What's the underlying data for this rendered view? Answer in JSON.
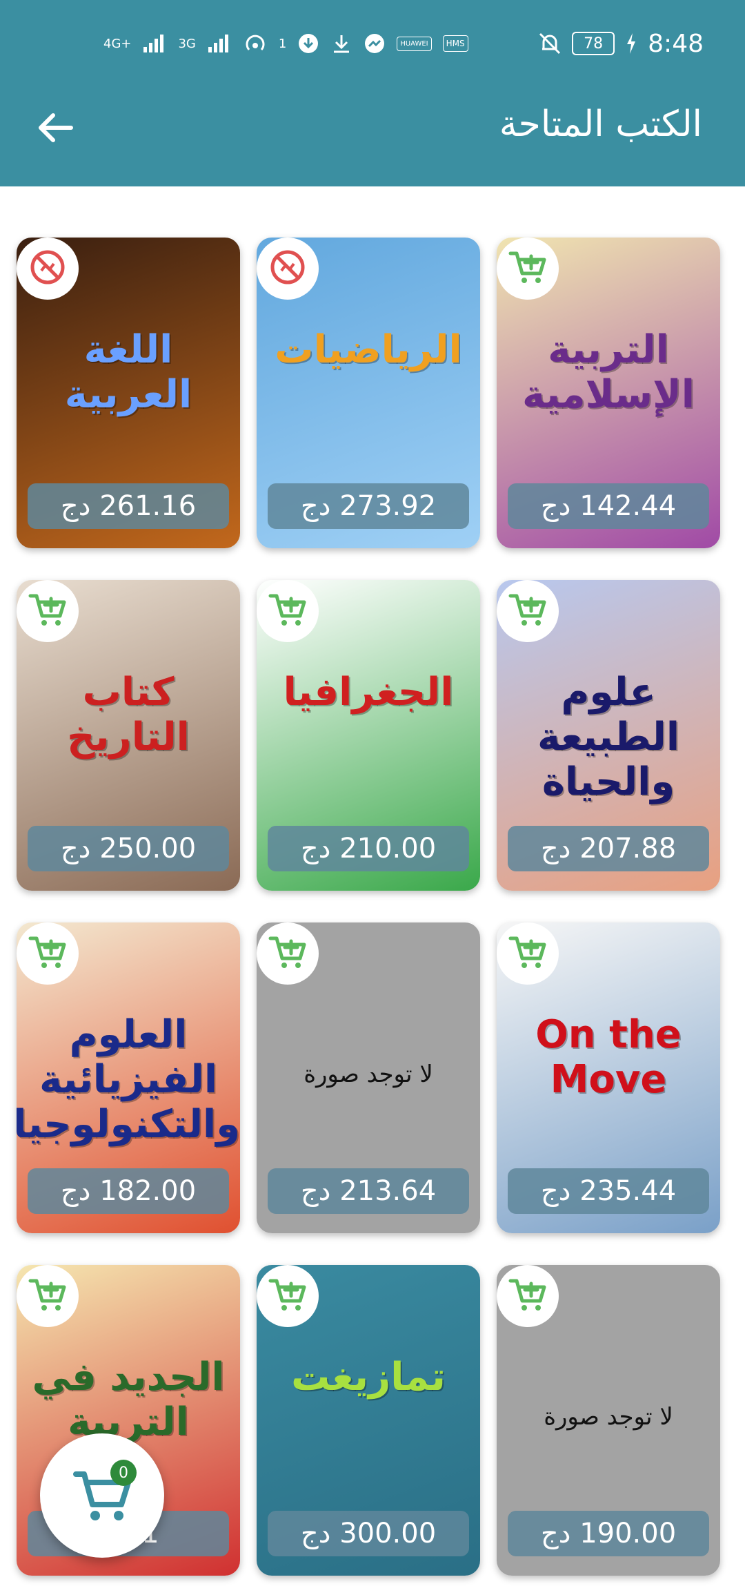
{
  "status_bar": {
    "network1": "4G+",
    "network2": "3G",
    "hotspot_count": "1",
    "carrier_tag1": "HUAWEI",
    "carrier_tag2": "HMS",
    "battery": "78",
    "time": "8:48"
  },
  "header": {
    "title": "الكتب المتاحة"
  },
  "books": [
    {
      "price": "261.16 دج",
      "badge": "unavailable-icon",
      "cover_text": "اللغة العربية",
      "cover_colors": [
        "#3a1f10",
        "#c2681c"
      ],
      "cover_text_color": "#6aa0ff",
      "has_image": true
    },
    {
      "price": "273.92 دج",
      "badge": "unavailable-icon",
      "cover_text": "الرياضيات",
      "cover_colors": [
        "#62a8de",
        "#9fd0f5"
      ],
      "cover_text_color": "#f0a020",
      "has_image": true
    },
    {
      "price": "142.44 دج",
      "badge": "add-to-cart-icon",
      "cover_text": "التربية الإسلامية",
      "cover_colors": [
        "#f0e4b0",
        "#a04aa6"
      ],
      "cover_text_color": "#6a2c8a",
      "has_image": true
    },
    {
      "price": "250.00 دج",
      "badge": "add-to-cart-icon",
      "cover_text": "كتاب التاريخ",
      "cover_colors": [
        "#e8ddd0",
        "#8a6a55"
      ],
      "cover_text_color": "#cc2020",
      "has_image": true
    },
    {
      "price": "210.00 دج",
      "badge": "add-to-cart-icon",
      "cover_text": "الجغرافيا",
      "cover_colors": [
        "#ffffff",
        "#3aa84a"
      ],
      "cover_text_color": "#d02020",
      "has_image": true
    },
    {
      "price": "207.88 دج",
      "badge": "add-to-cart-icon",
      "cover_text": "علوم الطبيعة والحياة",
      "cover_colors": [
        "#b8c8ee",
        "#e8a080"
      ],
      "cover_text_color": "#1a1a6a",
      "has_image": true
    },
    {
      "price": "182.00 دج",
      "badge": "add-to-cart-icon",
      "cover_text": "العلوم الفيزيائية والتكنولوجيا",
      "cover_colors": [
        "#f3e8d0",
        "#e05030"
      ],
      "cover_text_color": "#1a2a8a",
      "has_image": true
    },
    {
      "price": "213.64 دج",
      "badge": "add-to-cart-icon",
      "cover_text": "",
      "cover_colors": [
        "#a3a3a3",
        "#a3a3a3"
      ],
      "cover_text_color": "#000000",
      "has_image": false,
      "no_image_text": "لا توجد صورة"
    },
    {
      "price": "235.44 دج",
      "badge": "add-to-cart-icon",
      "cover_text": "On the Move",
      "cover_colors": [
        "#f6f6f6",
        "#7aa0c8"
      ],
      "cover_text_color": "#d0101a",
      "has_image": true
    },
    {
      "price": "5.01",
      "badge": "add-to-cart-icon",
      "cover_text": "الجديد في التربية",
      "cover_colors": [
        "#f5e6b0",
        "#d03030"
      ],
      "cover_text_color": "#2a6a2a",
      "has_image": true
    },
    {
      "price": "300.00 دج",
      "badge": "add-to-cart-icon",
      "cover_text": "تمازيغت",
      "cover_colors": [
        "#3a8aa0",
        "#2a6f86"
      ],
      "cover_text_color": "#a8e040",
      "has_image": true
    },
    {
      "price": "190.00 دج",
      "badge": "add-to-cart-icon",
      "cover_text": "",
      "cover_colors": [
        "#a3a3a3",
        "#a3a3a3"
      ],
      "cover_text_color": "#000000",
      "has_image": false,
      "no_image_text": "لا توجد صورة"
    }
  ],
  "cart": {
    "count": "0"
  },
  "colors": {
    "appbar": "#3b8fa1",
    "add_icon": "#5cb85c",
    "unavailable_icon": "#e05050"
  }
}
